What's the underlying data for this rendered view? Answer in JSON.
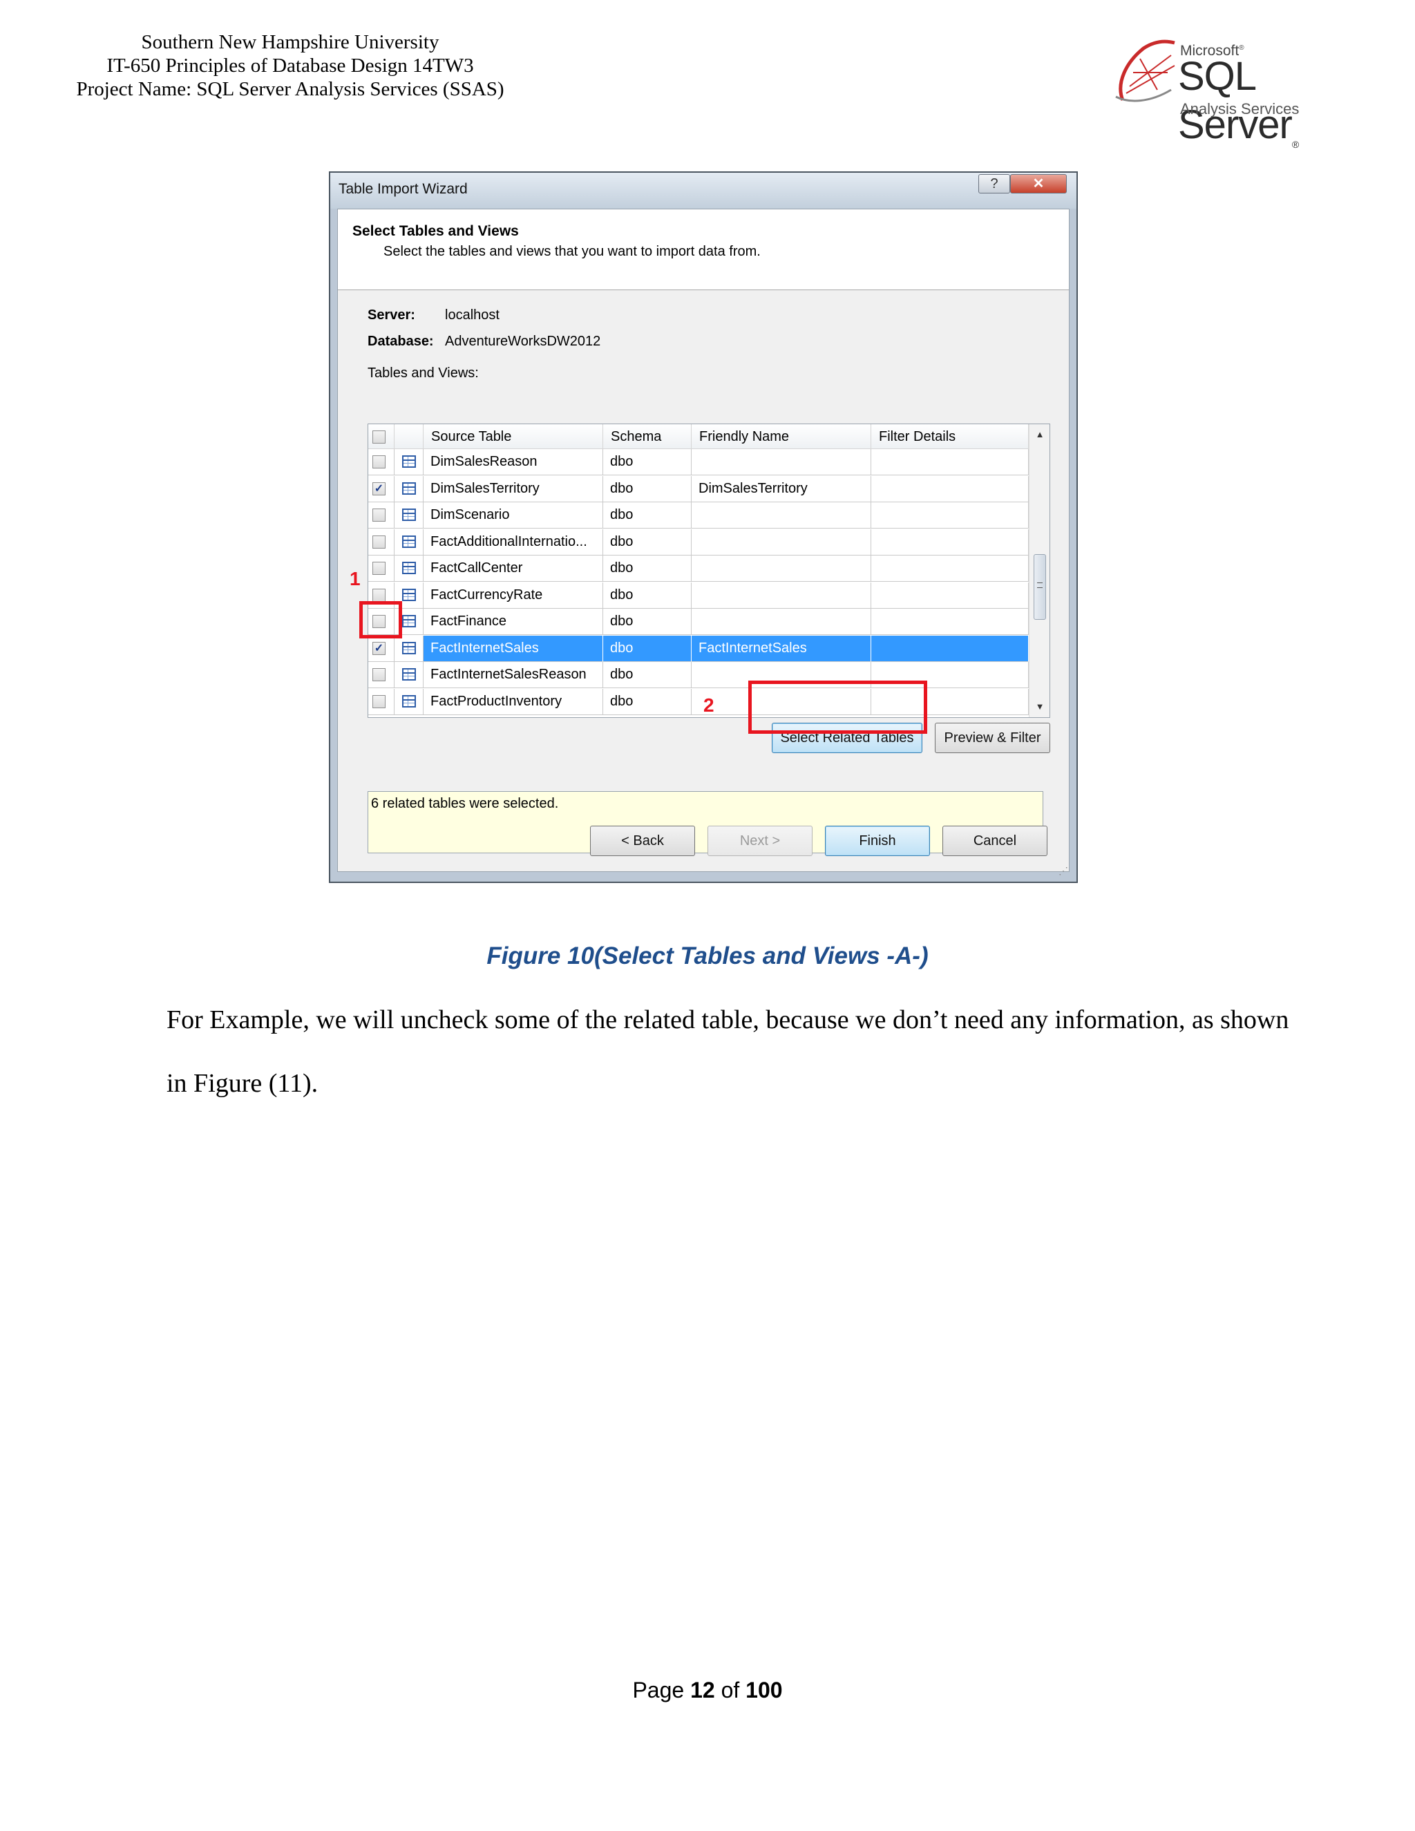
{
  "header": {
    "line1": "Southern New Hampshire University",
    "line2": "IT-650 Principles of Database Design 14TW3",
    "line3": "Project Name: SQL Server Analysis Services (SSAS)"
  },
  "logo": {
    "microsoft": "Microsoft",
    "product": "SQL Server",
    "subtitle": "Analysis Services"
  },
  "wizard": {
    "title": "Table Import Wizard",
    "help_glyph": "?",
    "close_glyph": "✕",
    "heading": "Select Tables and Views",
    "description": "Select the tables and views that you want to import data from.",
    "server_label": "Server:",
    "server_value": "localhost",
    "database_label": "Database:",
    "database_value": "AdventureWorksDW2012",
    "tables_label": "Tables and Views:",
    "columns": [
      "Source Table",
      "Schema",
      "Friendly Name",
      "Filter Details"
    ],
    "rows": [
      {
        "source": "DimSalesReason",
        "schema": "dbo",
        "friendly": "",
        "filter": "",
        "checked": false,
        "selected": false
      },
      {
        "source": "DimSalesTerritory",
        "schema": "dbo",
        "friendly": "DimSalesTerritory",
        "filter": "",
        "checked": true,
        "selected": false
      },
      {
        "source": "DimScenario",
        "schema": "dbo",
        "friendly": "",
        "filter": "",
        "checked": false,
        "selected": false
      },
      {
        "source": "FactAdditionalInternatio...",
        "schema": "dbo",
        "friendly": "",
        "filter": "",
        "checked": false,
        "selected": false
      },
      {
        "source": "FactCallCenter",
        "schema": "dbo",
        "friendly": "",
        "filter": "",
        "checked": false,
        "selected": false
      },
      {
        "source": "FactCurrencyRate",
        "schema": "dbo",
        "friendly": "",
        "filter": "",
        "checked": false,
        "selected": false
      },
      {
        "source": "FactFinance",
        "schema": "dbo",
        "friendly": "",
        "filter": "",
        "checked": false,
        "selected": false
      },
      {
        "source": "FactInternetSales",
        "schema": "dbo",
        "friendly": "FactInternetSales",
        "filter": "",
        "checked": true,
        "selected": true
      },
      {
        "source": "FactInternetSalesReason",
        "schema": "dbo",
        "friendly": "",
        "filter": "",
        "checked": false,
        "selected": false
      },
      {
        "source": "FactProductInventory",
        "schema": "dbo",
        "friendly": "",
        "filter": "",
        "checked": false,
        "selected": false
      }
    ],
    "select_related_label": "Select Related Tables",
    "preview_filter_label": "Preview & Filter",
    "status_message": "6 related tables were selected.",
    "back_label": "< Back",
    "next_label": "Next >",
    "finish_label": "Finish",
    "cancel_label": "Cancel",
    "annotation_1": "1",
    "annotation_2": "2"
  },
  "caption": "Figure 10(Select Tables and Views -A-)",
  "paragraph": "For Example, we will uncheck some of the related table, because we don’t need any information, as shown in Figure (11).",
  "footer": {
    "page_word": "Page",
    "page_number": "12",
    "of_word": "of",
    "page_total": "100"
  },
  "colors": {
    "selection": "#3399ff",
    "annotation": "#e8151f",
    "caption": "#1f4e8c",
    "status_bg": "#ffffe1"
  }
}
